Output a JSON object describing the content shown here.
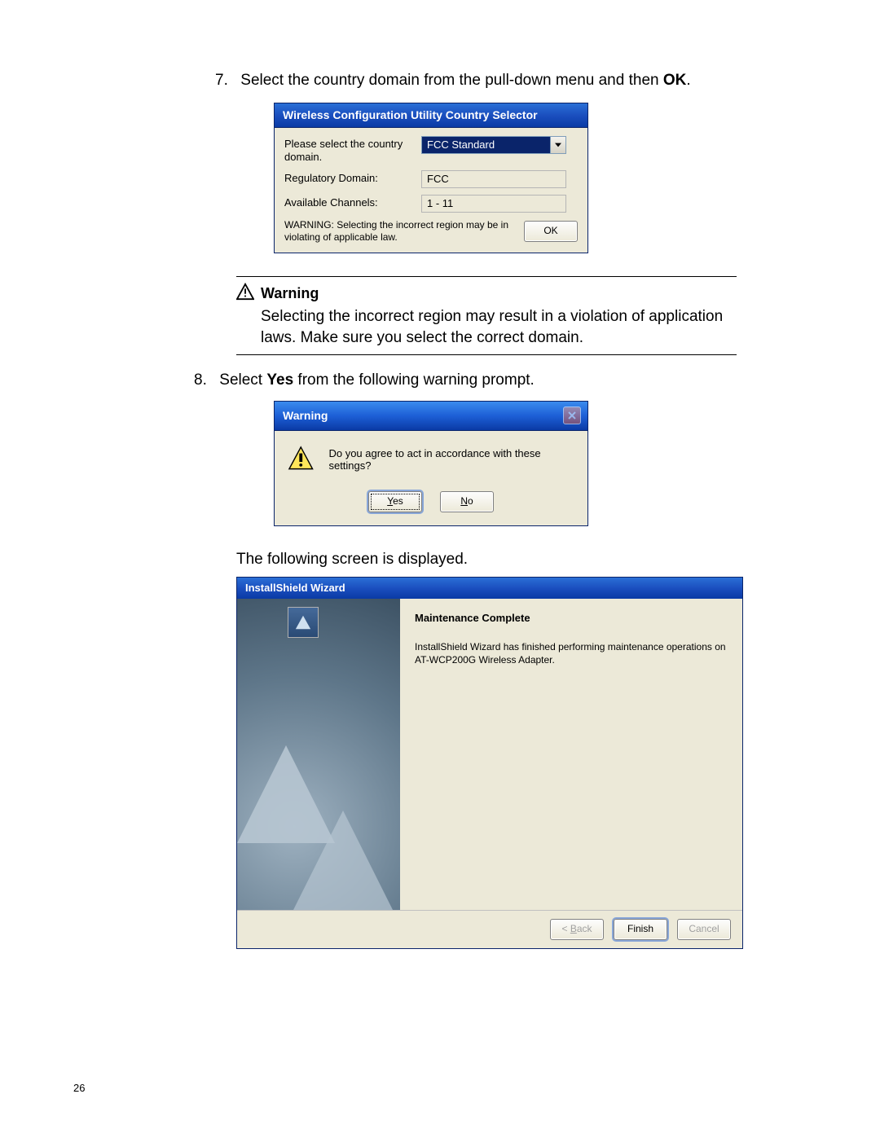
{
  "steps": {
    "s7_num": "7.",
    "s7_a": "Select the country domain from the pull-down menu and then ",
    "s7_b": "OK",
    "s7_c": ".",
    "s8_num": "8.",
    "s8_a": "Select ",
    "s8_b": "Yes",
    "s8_c": " from the following warning prompt."
  },
  "dlg1": {
    "title": "Wireless Configuration Utility Country Selector",
    "label_country": "Please select the country domain.",
    "combo_value": "FCC Standard",
    "label_regulatory": "Regulatory Domain:",
    "val_regulatory": "FCC",
    "label_channels": "Available Channels:",
    "val_channels": "1 - 11",
    "warn": "WARNING: Selecting the incorrect region may be in violating of applicable law.",
    "ok": "OK"
  },
  "callout": {
    "head": "Warning",
    "body": "Selecting the incorrect region may result in a violation of application laws. Make sure you select the correct domain."
  },
  "dlg2": {
    "title": "Warning",
    "msg": "Do you agree to act in accordance with these settings?",
    "yes_u": "Y",
    "yes_r": "es",
    "no_u": "N",
    "no_r": "o"
  },
  "after8": "The following screen is displayed.",
  "dlg3": {
    "title": "InstallShield Wizard",
    "heading": "Maintenance Complete",
    "body": "InstallShield Wizard has finished performing maintenance operations on AT-WCP200G Wireless Adapter.",
    "back_u": "B",
    "back_pre": "< ",
    "back_r": "ack",
    "finish": "Finish",
    "cancel": "Cancel"
  },
  "page_number": "26"
}
